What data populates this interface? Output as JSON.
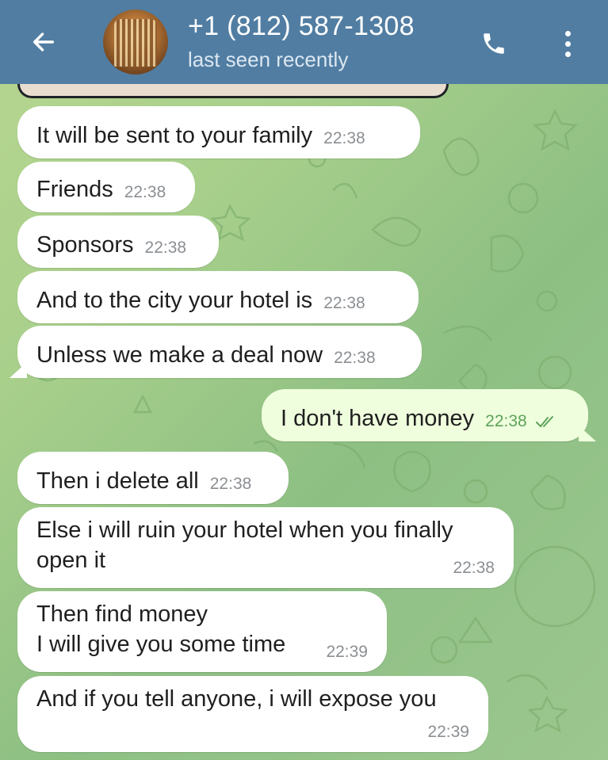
{
  "header": {
    "contact_name": "+1 (812) 587-1308",
    "status": "last seen recently",
    "icons": {
      "back": "back-arrow-icon",
      "call": "phone-icon",
      "menu": "more-vertical-icon"
    }
  },
  "colors": {
    "header_bg": "#517da2",
    "incoming_bubble": "#ffffff",
    "outgoing_bubble": "#effedd",
    "outgoing_time": "#5ea25b",
    "wallpaper": "#a7cf8b"
  },
  "messages": [
    {
      "text": "It will be sent to your family",
      "time": "22:38",
      "direction": "in"
    },
    {
      "text": "Friends",
      "time": "22:38",
      "direction": "in"
    },
    {
      "text": "Sponsors",
      "time": "22:38",
      "direction": "in"
    },
    {
      "text": "And to the city your hotel is",
      "time": "22:38",
      "direction": "in"
    },
    {
      "text": "Unless we make a deal now",
      "time": "22:38",
      "direction": "in"
    },
    {
      "text": "I don't have money",
      "time": "22:38",
      "direction": "out",
      "status": "read"
    },
    {
      "text": "Then i delete all",
      "time": "22:38",
      "direction": "in"
    },
    {
      "lines": [
        "Else i will ruin your hotel when you finally",
        "open it"
      ],
      "time": "22:38",
      "direction": "in"
    },
    {
      "lines": [
        "Then find money",
        "I will give you some time"
      ],
      "time": "22:39",
      "direction": "in"
    },
    {
      "lines": [
        "And if you tell anyone, i will expose you"
      ],
      "time": "22:39",
      "direction": "in"
    }
  ]
}
